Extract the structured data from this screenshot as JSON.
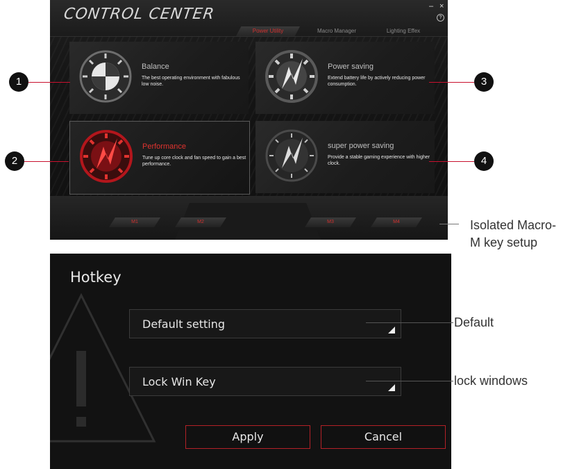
{
  "control_center": {
    "title": "CONTROL CENTER",
    "window_controls": {
      "minimize": "–",
      "close": "×",
      "help": "?"
    },
    "tabs": [
      {
        "label": "Power Utility",
        "active": true
      },
      {
        "label": "Macro Manager",
        "active": false
      },
      {
        "label": "Lighting Effex",
        "active": false
      }
    ],
    "modes": [
      {
        "name": "Balance",
        "desc": "The best operating environment with fabulous low noise.",
        "icon": "balance-dial-icon"
      },
      {
        "name": "Performance",
        "desc": "Tune up core clock and fan speed to gain a best performance.",
        "icon": "performance-dial-icon",
        "selected": true
      },
      {
        "name": "Power saving",
        "desc": "Extend battery life by actively reducing power consumption.",
        "icon": "power-saving-dial-icon"
      },
      {
        "name": "super power saving",
        "desc": "Provide a stable gaming experience with higher clock.",
        "icon": "super-power-saving-dial-icon"
      }
    ],
    "macro_keys": [
      "M1",
      "M2",
      "M3",
      "M4"
    ]
  },
  "callouts": {
    "numbers": [
      "1",
      "2",
      "3",
      "4"
    ],
    "macro": "Isolated Macro-M key setup",
    "macro_line1": "Isolated Macro-",
    "macro_line2": "M key setup",
    "default": "Default",
    "lock": "lock windows"
  },
  "hotkey": {
    "title": "Hotkey",
    "dropdown_1": "Default setting",
    "dropdown_2": "Lock Win Key",
    "apply": "Apply",
    "cancel": "Cancel"
  },
  "colors": {
    "accent": "#d0312f",
    "panel": "#121212",
    "callout_line": "#c8102e"
  }
}
